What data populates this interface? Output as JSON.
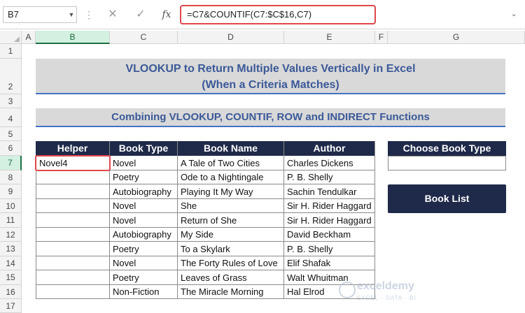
{
  "formula_bar": {
    "name_box": "B7",
    "cancel_icon": "✕",
    "enter_icon": "✓",
    "fx_label": "fx",
    "formula": "=C7&COUNTIF(C7:$C$16,C7)"
  },
  "columns": [
    "A",
    "B",
    "C",
    "D",
    "E",
    "F",
    "G"
  ],
  "rows": [
    "1",
    "2",
    "3",
    "4",
    "5",
    "6",
    "7",
    "8",
    "9",
    "10",
    "11",
    "12",
    "13",
    "14",
    "15",
    "16",
    "17"
  ],
  "title": {
    "line1": "VLOOKUP to Return Multiple Values Vertically in Excel",
    "line2": "(When a Criteria Matches)",
    "subtitle": "Combining VLOOKUP, COUNTIF, ROW and INDIRECT Functions"
  },
  "table": {
    "headers": [
      "Helper",
      "Book Type",
      "Book Name",
      "Author"
    ],
    "rows": [
      [
        "Novel4",
        "Novel",
        "A Tale of Two Cities",
        "Charles Dickens"
      ],
      [
        "",
        "Poetry",
        "Ode to a Nightingale",
        "P. B. Shelly"
      ],
      [
        "",
        "Autobiography",
        "Playing It My Way",
        "Sachin Tendulkar"
      ],
      [
        "",
        "Novel",
        "She",
        "Sir H. Rider Haggard"
      ],
      [
        "",
        "Novel",
        "Return of She",
        "Sir H. Rider Haggard"
      ],
      [
        "",
        "Autobiography",
        "My Side",
        "David Beckham"
      ],
      [
        "",
        "Poetry",
        "To a Skylark",
        "P. B. Shelly"
      ],
      [
        "",
        "Novel",
        "The Forty Rules of Love",
        "Elif Shafak"
      ],
      [
        "",
        "Poetry",
        "Leaves of Grass",
        "Walt Whuitman"
      ],
      [
        "",
        "Non-Fiction",
        "The Miracle Morning",
        "Hal Elrod"
      ]
    ]
  },
  "panel": {
    "choose_header": "Choose Book Type",
    "choose_value": "",
    "book_list_button": "Book List"
  },
  "watermark": {
    "name": "exceldemy",
    "tagline": "EXCEL · DATA · BI"
  },
  "colors": {
    "header_bg": "#1f2a4a",
    "banner_bg": "#d9d9d9",
    "banner_text": "#3b5998",
    "accent_line": "#4472c4",
    "highlight": "#e0474c"
  }
}
